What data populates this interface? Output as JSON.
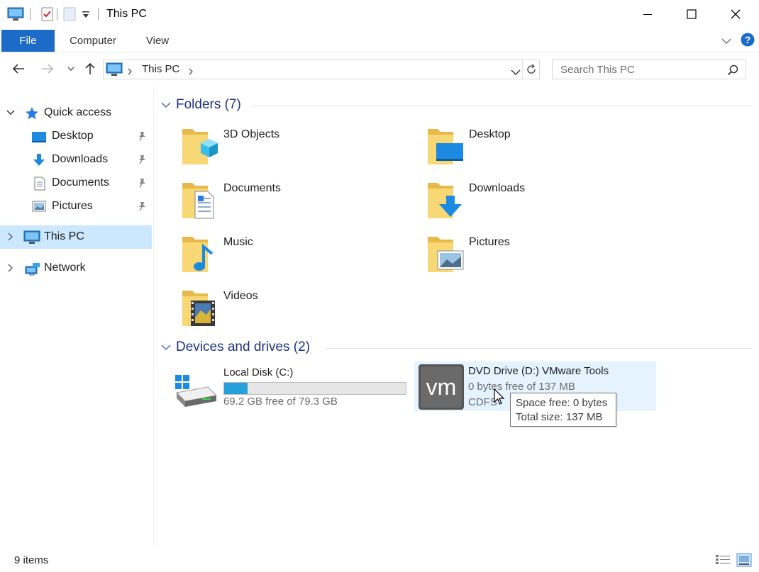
{
  "window": {
    "title": "This PC"
  },
  "ribbon": {
    "tabs": [
      "File",
      "Computer",
      "View"
    ]
  },
  "address": {
    "path": "This PC",
    "search_placeholder": "Search This PC"
  },
  "sidebar": {
    "items": [
      {
        "label": "Quick access"
      },
      {
        "label": "Desktop"
      },
      {
        "label": "Downloads"
      },
      {
        "label": "Documents"
      },
      {
        "label": "Pictures"
      },
      {
        "label": "This PC"
      },
      {
        "label": "Network"
      }
    ]
  },
  "folders": {
    "header": "Folders (7)",
    "items": [
      "3D Objects",
      "Desktop",
      "Documents",
      "Downloads",
      "Music",
      "Pictures",
      "Videos"
    ]
  },
  "devices": {
    "header": "Devices and drives (2)",
    "local": {
      "name": "Local Disk (C:)",
      "free": "69.2 GB free of 79.3 GB",
      "used_fraction": 0.127
    },
    "dvd": {
      "name": "DVD Drive (D:) VMware Tools",
      "free": "0 bytes free of 137 MB",
      "fs": "CDFS",
      "logo": "vm"
    }
  },
  "tooltip": {
    "line1": "Space free: 0 bytes",
    "line2": "Total size: 137 MB"
  },
  "status": {
    "count": "9 items"
  },
  "colors": {
    "accent": "#1c6bc7",
    "selection": "#cce8ff",
    "header_text": "#1e3287",
    "bar_fill": "#26a0da"
  }
}
